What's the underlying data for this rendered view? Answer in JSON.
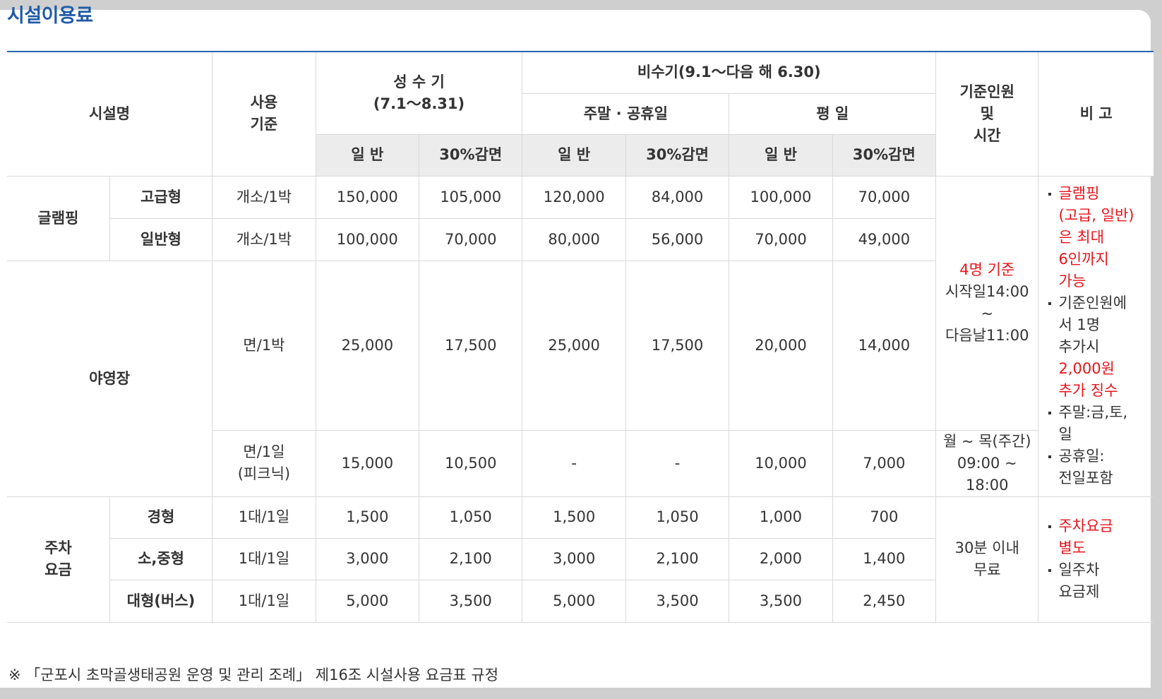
{
  "title": "시설이용료",
  "headers": {
    "facility": "시설명",
    "usage_line1": "사용",
    "usage_line2": "기준",
    "peak_line1": "성 수 기",
    "peak_line2": "(7.1～8.31)",
    "offpeak": "비수기(9.1～다음 해 6.30)",
    "weekend": "주말 · 공휴일",
    "weekday": "평 일",
    "capacity_line1": "기준인원",
    "capacity_line2": "및",
    "capacity_line3": "시간",
    "remarks": "비 고",
    "general": "일 반",
    "discount": "30%감면"
  },
  "glamping": {
    "name": "글램핑",
    "rows": [
      {
        "type": "고급형",
        "unit": "개소/1박",
        "values": [
          "150,000",
          "105,000",
          "120,000",
          "84,000",
          "100,000",
          "70,000"
        ]
      },
      {
        "type": "일반형",
        "unit": "개소/1박",
        "values": [
          "100,000",
          "70,000",
          "80,000",
          "56,000",
          "70,000",
          "49,000"
        ]
      }
    ]
  },
  "camping": {
    "name": "야영장",
    "rows": [
      {
        "unit": "면/1박",
        "values": [
          "25,000",
          "17,500",
          "25,000",
          "17,500",
          "20,000",
          "14,000"
        ]
      },
      {
        "unit_line1": "면/1일",
        "unit_line2": "(피크닉)",
        "values": [
          "15,000",
          "10,500",
          "-",
          "-",
          "10,000",
          "7,000"
        ]
      }
    ]
  },
  "capacity": {
    "base_red": "4명 기준",
    "checkin": "시작일14:00",
    "tilde": "~",
    "checkout": "다음날11:00",
    "picnic_line1": "월 ~ 목(주간)",
    "picnic_line2": "09:00 ~ 18:00"
  },
  "lodging_notes": {
    "note1_red_lines": [
      "글램핑",
      "(고급, 일반)",
      "은 최대",
      "6인까지",
      "가능"
    ],
    "note2_lines": [
      "기준인원에",
      "서 1명",
      "추가시"
    ],
    "note2_red_lines": [
      "2,000원",
      "추가 징수"
    ],
    "note3_lines": [
      "주말:금,토,",
      "일"
    ],
    "note4_lines": [
      "공휴일:",
      "전일포함"
    ]
  },
  "parking": {
    "name_line1": "주차",
    "name_line2": "요금",
    "rows": [
      {
        "type": "경형",
        "unit": "1대/1일",
        "values": [
          "1,500",
          "1,050",
          "1,500",
          "1,050",
          "1,000",
          "700"
        ]
      },
      {
        "type": "소,중형",
        "unit": "1대/1일",
        "values": [
          "3,000",
          "2,100",
          "3,000",
          "2,100",
          "2,000",
          "1,400"
        ]
      },
      {
        "type": "대형(버스)",
        "unit": "1대/1일",
        "values": [
          "5,000",
          "3,500",
          "5,000",
          "3,500",
          "3,500",
          "2,450"
        ]
      }
    ],
    "free_line1": "30분 이내",
    "free_line2": "무료",
    "note1_red_lines": [
      "주차요금",
      "별도"
    ],
    "note2_lines": [
      "일주차",
      "요금제"
    ]
  },
  "footnote": "※ 「군포시 초막골생태공원 운영 및 관리 조례」 제16조 시설사용 요금표 규정"
}
